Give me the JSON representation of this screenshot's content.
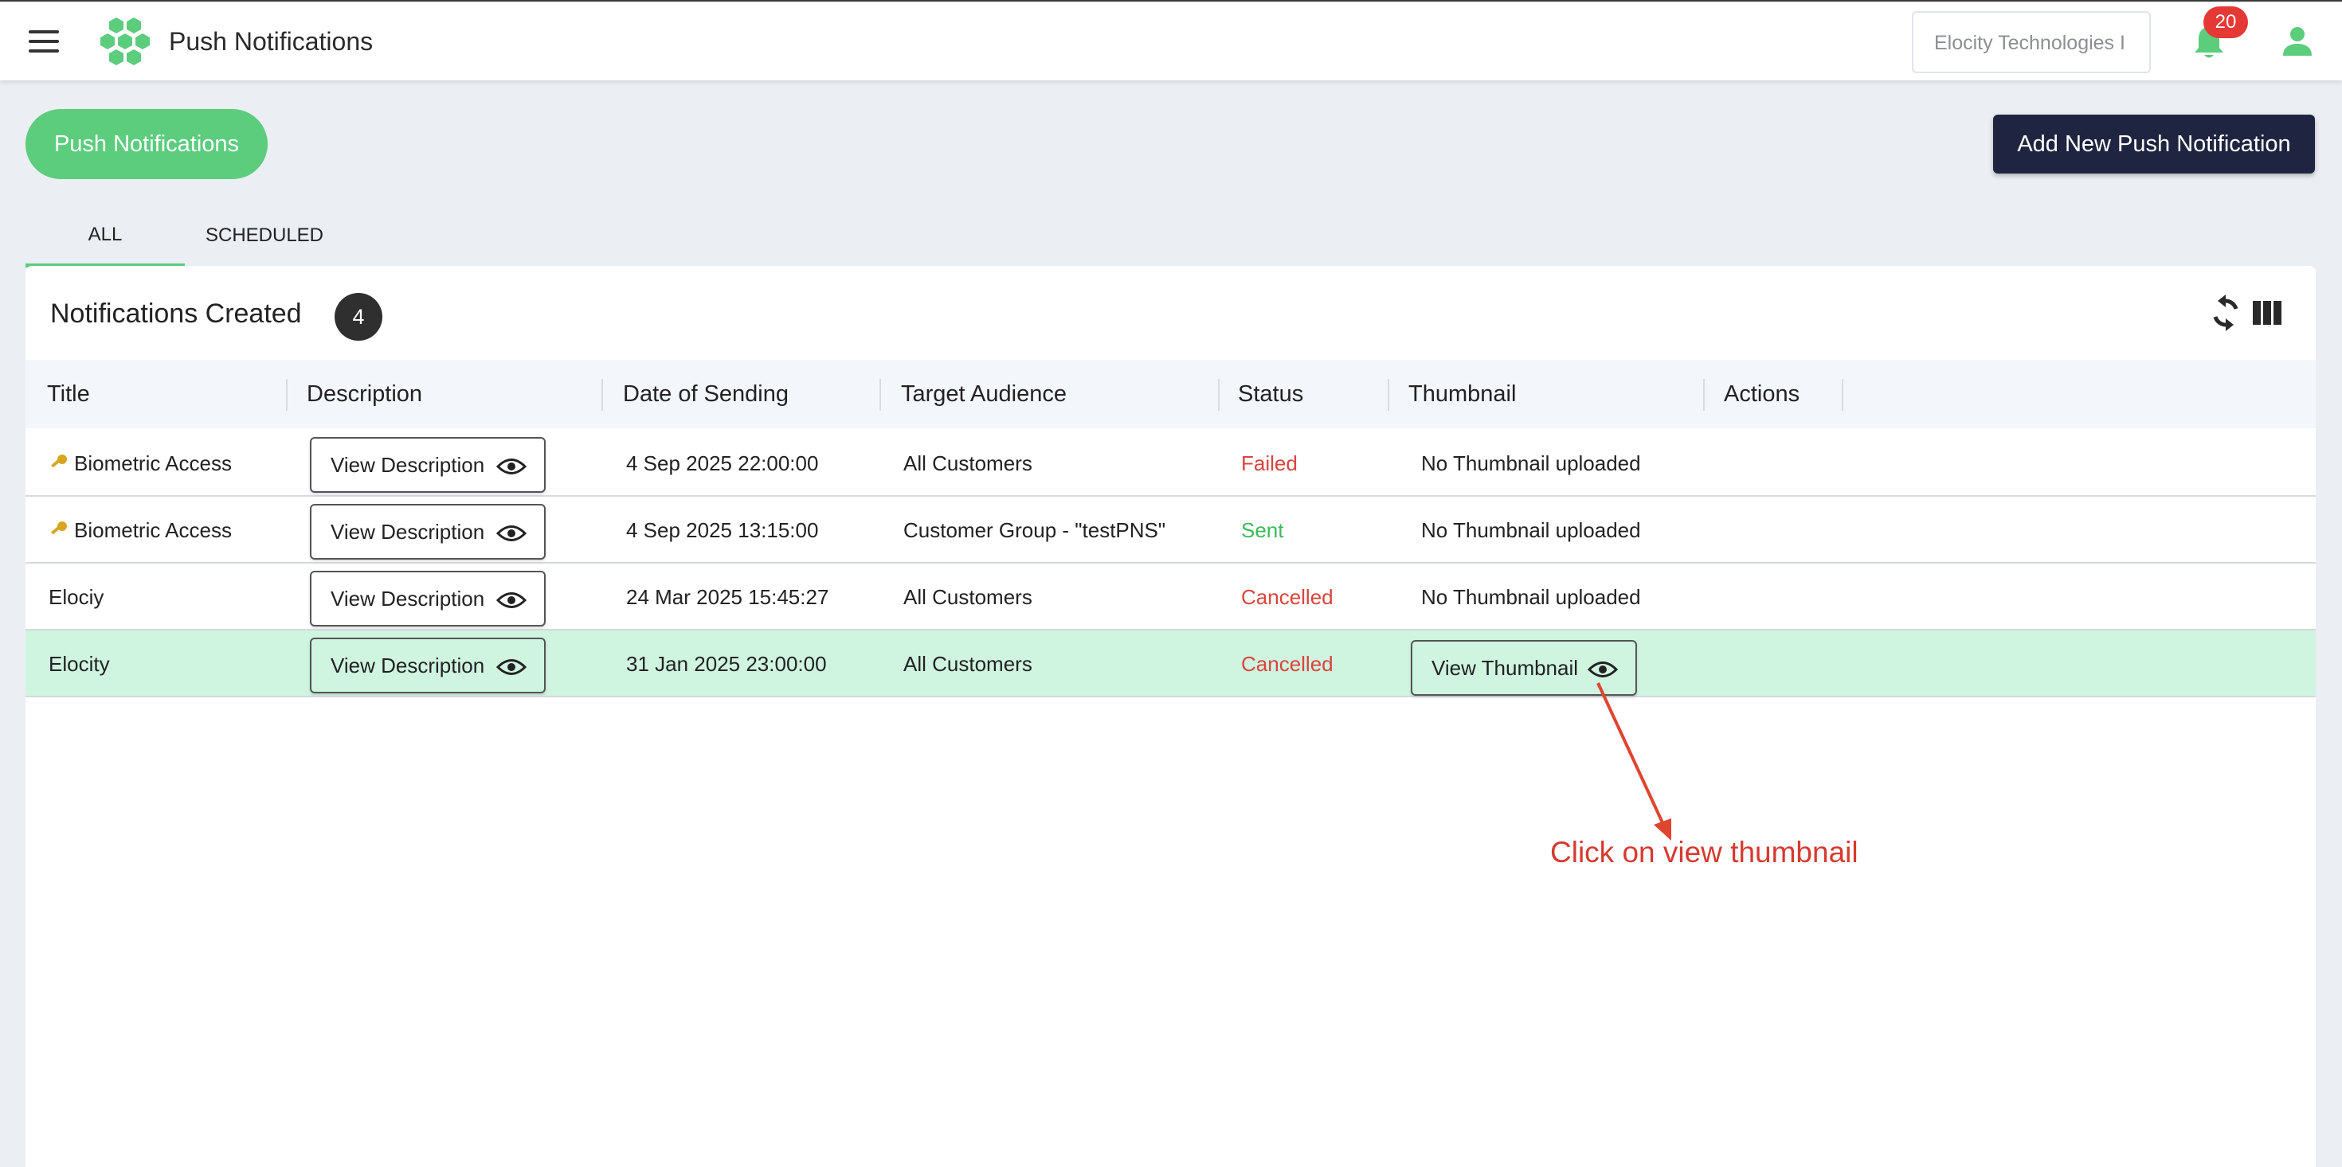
{
  "header": {
    "app_title": "Push Notifications",
    "company_placeholder": "Elocity Technologies I",
    "notification_count": "20"
  },
  "page": {
    "pill_label": "Push Notifications",
    "add_button_label": "Add New Push Notification"
  },
  "tabs": [
    {
      "label": "ALL",
      "active": true
    },
    {
      "label": "SCHEDULED",
      "active": false
    }
  ],
  "card": {
    "title": "Notifications Created",
    "count": "4"
  },
  "table": {
    "columns": [
      "Title",
      "Description",
      "Date of Sending",
      "Target Audience",
      "Status",
      "Thumbnail",
      "Actions"
    ],
    "rows": [
      {
        "title": "Biometric Access",
        "has_key_icon": true,
        "description_button": "View Description",
        "date": "4 Sep 2025 22:00:00",
        "audience": "All Customers",
        "status": "Failed",
        "thumbnail": "No Thumbnail uploaded"
      },
      {
        "title": "Biometric Access",
        "has_key_icon": true,
        "description_button": "View Description",
        "date": "4 Sep 2025 13:15:00",
        "audience": "Customer Group - \"testPNS\"",
        "status": "Sent",
        "thumbnail": "No Thumbnail uploaded"
      },
      {
        "title": "Elociy",
        "has_key_icon": false,
        "description_button": "View Description",
        "date": "24 Mar 2025 15:45:27",
        "audience": "All Customers",
        "status": "Cancelled",
        "thumbnail": "No Thumbnail uploaded"
      },
      {
        "title": "Elocity",
        "has_key_icon": false,
        "description_button": "View Description",
        "date": "31 Jan 2025 23:00:00",
        "audience": "All Customers",
        "status": "Cancelled",
        "thumbnail_button": "View Thumbnail"
      }
    ]
  },
  "annotation": {
    "text": "Click on view thumbnail"
  },
  "colors": {
    "brand_green": "#5ccc7d",
    "dark_button": "#1f2540",
    "status_failed": "#d9453d",
    "status_sent": "#3cba5a",
    "highlight_row": "#cff5e0",
    "annotation": "#d63a2f"
  },
  "icons": [
    "menu-icon",
    "logo-icon",
    "bell-icon",
    "user-icon",
    "refresh-icon",
    "columns-icon",
    "eye-icon",
    "key-icon",
    "arrow-icon"
  ]
}
